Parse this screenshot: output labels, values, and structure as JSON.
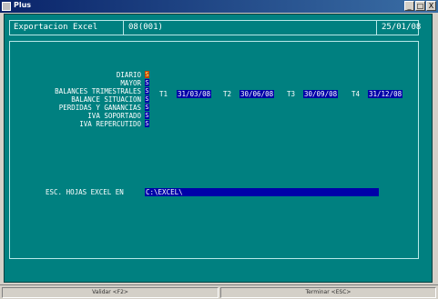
{
  "window": {
    "title": "Plus",
    "buttons": [
      "_",
      "□",
      "X"
    ]
  },
  "header": {
    "screen_name": "Exportacion Excel",
    "company": "08(001)",
    "date": "25/01/08"
  },
  "options": [
    {
      "label": "DIARIO",
      "value": "S"
    },
    {
      "label": "MAYOR",
      "value": "S"
    },
    {
      "label": "BALANCES TRIMESTRALES",
      "value": "S"
    },
    {
      "label": "BALANCE SITUACION",
      "value": "S"
    },
    {
      "label": "PERDIDAS Y GANANCIAS",
      "value": "S"
    },
    {
      "label": "IVA SOPORTADO",
      "value": "S"
    },
    {
      "label": "IVA REPERCUTIDO",
      "value": "S"
    }
  ],
  "quarters": [
    {
      "label": "T1",
      "date": "31/03/08"
    },
    {
      "label": "T2",
      "date": "30/06/08"
    },
    {
      "label": "T3",
      "date": "30/09/08"
    },
    {
      "label": "T4",
      "date": "31/12/08"
    }
  ],
  "excel_path": {
    "label": "ESC. HOJAS EXCEL EN",
    "value": "C:\\EXCEL\\"
  },
  "statusbar": {
    "validate": "Validar <F2>",
    "finish": "Terminar <ESC>"
  },
  "colors": {
    "console_bg": "#008080",
    "field_bg": "#0000a8",
    "cursor_bg": "#c04000"
  }
}
